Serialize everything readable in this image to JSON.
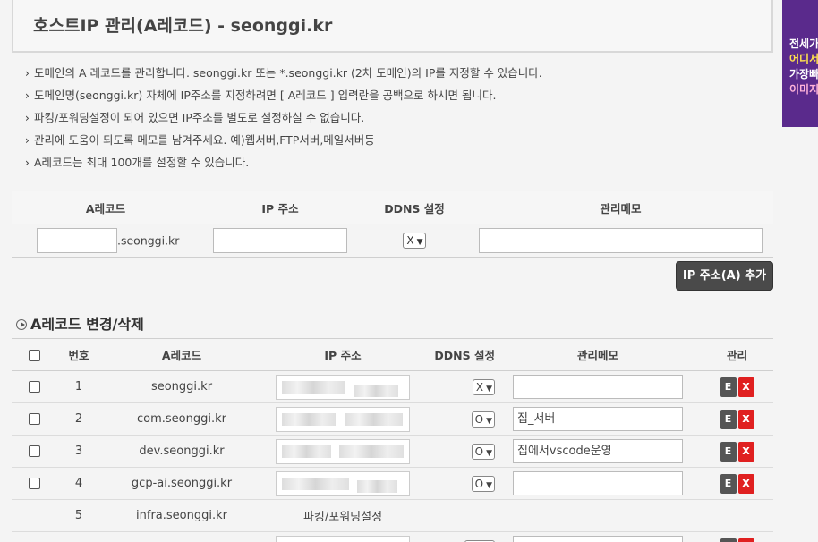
{
  "title": "호스트IP 관리(A레코드) - seonggi.kr",
  "ad": {
    "lines": [
      {
        "text": "전세가",
        "color": "#ffffff"
      },
      {
        "text": "어디서",
        "color": "#ffe14d"
      },
      {
        "text": "가장빠",
        "color": "#ffffff"
      },
      {
        "text": "이미지",
        "color": "#ffb3d9"
      }
    ]
  },
  "notes": [
    "도메인의 A 레코드를 관리합니다. seonggi.kr 또는 *.seonggi.kr (2차 도메인)의 IP를 지정할 수 있습니다.",
    "도메인명(seonggi.kr) 자체에 IP주소를 지정하려면 [ A레코드 ] 입력란을 공백으로 하시면 됩니다.",
    "파킹/포워딩설정이 되어 있으면 IP주소를 별도로 설정하실 수 없습니다.",
    "관리에 도움이 되도록 메모를 남겨주세요. 예)웹서버,FTP서버,메일서버등",
    "A레코드는 최대 100개를 설정할 수 있습니다."
  ],
  "add_form": {
    "headers": [
      "A레코드",
      "IP 주소",
      "DDNS 설정",
      "관리메모"
    ],
    "domain_suffix": ".seonggi.kr",
    "ddns_value": "X",
    "add_button": "IP 주소(A) 추가"
  },
  "section_title": "A레코드 변경/삭제",
  "records": {
    "headers": [
      "번호",
      "A레코드",
      "IP 주소",
      "DDNS 설정",
      "관리메모",
      "관리"
    ],
    "edit_label": "E",
    "delete_label": "X",
    "parking_label": "파킹/포워딩설정",
    "rows": [
      {
        "num": "1",
        "record": "seonggi.kr",
        "ddns": "X",
        "memo": ""
      },
      {
        "num": "2",
        "record": "com.seonggi.kr",
        "ddns": "O",
        "memo": "집_서버"
      },
      {
        "num": "3",
        "record": "dev.seonggi.kr",
        "ddns": "O",
        "memo": "집에서vscode운영"
      },
      {
        "num": "4",
        "record": "gcp-ai.seonggi.kr",
        "ddns": "O",
        "memo": ""
      },
      {
        "num": "5",
        "record": "infra.seonggi.kr"
      }
    ]
  }
}
